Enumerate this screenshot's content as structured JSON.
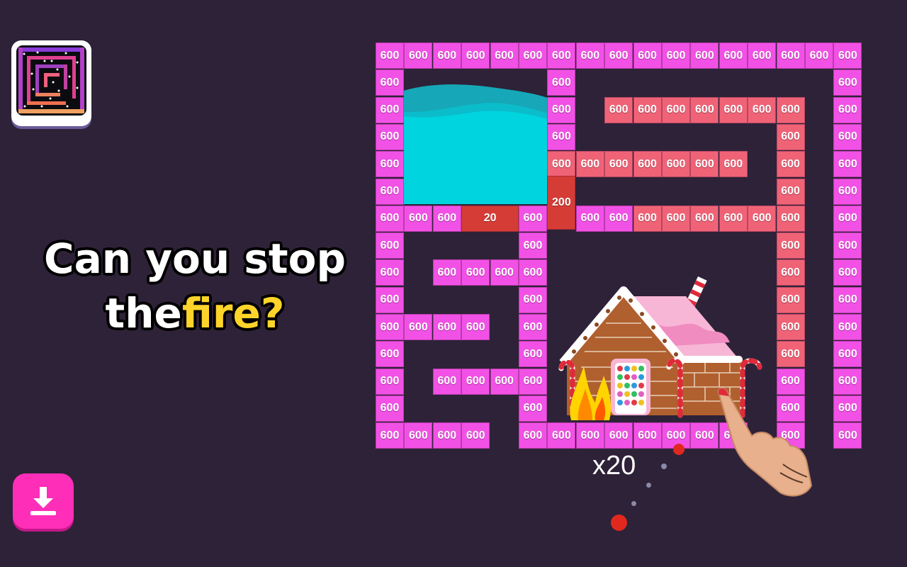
{
  "game": {
    "headline_line1": "Can you stop",
    "headline_line2_prefix": "the",
    "headline_line2_highlight": "fire?",
    "multiplier": "x20",
    "colors": {
      "background": "#2e2238",
      "brick_magenta": "#f251e6",
      "brick_salmon": "#f06377",
      "brick_red": "#d63c36",
      "water": "#00d4de",
      "download_button": "#ff2eb8",
      "highlight_text": "#ffd42a",
      "ball": "#e0281e"
    }
  },
  "bricks": [
    {
      "row": 0,
      "col": 0,
      "value": "600",
      "color": "m"
    },
    {
      "row": 0,
      "col": 1,
      "value": "600",
      "color": "m"
    },
    {
      "row": 0,
      "col": 2,
      "value": "600",
      "color": "m"
    },
    {
      "row": 0,
      "col": 3,
      "value": "600",
      "color": "m"
    },
    {
      "row": 0,
      "col": 4,
      "value": "600",
      "color": "m"
    },
    {
      "row": 0,
      "col": 5,
      "value": "600",
      "color": "m"
    },
    {
      "row": 0,
      "col": 6,
      "value": "600",
      "color": "m"
    },
    {
      "row": 0,
      "col": 7,
      "value": "600",
      "color": "m"
    },
    {
      "row": 0,
      "col": 8,
      "value": "600",
      "color": "m"
    },
    {
      "row": 0,
      "col": 9,
      "value": "600",
      "color": "m"
    },
    {
      "row": 0,
      "col": 10,
      "value": "600",
      "color": "m"
    },
    {
      "row": 0,
      "col": 11,
      "value": "600",
      "color": "m"
    },
    {
      "row": 0,
      "col": 12,
      "value": "600",
      "color": "m"
    },
    {
      "row": 0,
      "col": 13,
      "value": "600",
      "color": "m"
    },
    {
      "row": 0,
      "col": 14,
      "value": "600",
      "color": "m"
    },
    {
      "row": 0,
      "col": 15,
      "value": "600",
      "color": "m"
    },
    {
      "row": 0,
      "col": 16,
      "value": "600",
      "color": "m"
    },
    {
      "row": 1,
      "col": 0,
      "value": "600",
      "color": "m"
    },
    {
      "row": 1,
      "col": 6,
      "value": "600",
      "color": "m"
    },
    {
      "row": 1,
      "col": 16,
      "value": "600",
      "color": "m"
    },
    {
      "row": 2,
      "col": 0,
      "value": "600",
      "color": "m"
    },
    {
      "row": 2,
      "col": 6,
      "value": "600",
      "color": "m"
    },
    {
      "row": 2,
      "col": 8,
      "value": "600",
      "color": "s"
    },
    {
      "row": 2,
      "col": 9,
      "value": "600",
      "color": "s"
    },
    {
      "row": 2,
      "col": 10,
      "value": "600",
      "color": "s"
    },
    {
      "row": 2,
      "col": 11,
      "value": "600",
      "color": "s"
    },
    {
      "row": 2,
      "col": 12,
      "value": "600",
      "color": "s"
    },
    {
      "row": 2,
      "col": 13,
      "value": "600",
      "color": "s"
    },
    {
      "row": 2,
      "col": 14,
      "value": "600",
      "color": "s"
    },
    {
      "row": 2,
      "col": 16,
      "value": "600",
      "color": "m"
    },
    {
      "row": 3,
      "col": 0,
      "value": "600",
      "color": "m"
    },
    {
      "row": 3,
      "col": 6,
      "value": "600",
      "color": "m"
    },
    {
      "row": 3,
      "col": 14,
      "value": "600",
      "color": "s"
    },
    {
      "row": 3,
      "col": 16,
      "value": "600",
      "color": "m"
    },
    {
      "row": 4,
      "col": 0,
      "value": "600",
      "color": "m"
    },
    {
      "row": 4,
      "col": 6,
      "value": "600",
      "color": "s"
    },
    {
      "row": 4,
      "col": 7,
      "value": "600",
      "color": "s"
    },
    {
      "row": 4,
      "col": 8,
      "value": "600",
      "color": "s"
    },
    {
      "row": 4,
      "col": 9,
      "value": "600",
      "color": "s"
    },
    {
      "row": 4,
      "col": 10,
      "value": "600",
      "color": "s"
    },
    {
      "row": 4,
      "col": 11,
      "value": "600",
      "color": "s"
    },
    {
      "row": 4,
      "col": 12,
      "value": "600",
      "color": "s"
    },
    {
      "row": 4,
      "col": 14,
      "value": "600",
      "color": "s"
    },
    {
      "row": 4,
      "col": 16,
      "value": "600",
      "color": "m"
    },
    {
      "row": 5,
      "col": 0,
      "value": "600",
      "color": "m"
    },
    {
      "row": 5,
      "col": 6,
      "value": "200",
      "color": "r",
      "tall": true
    },
    {
      "row": 5,
      "col": 14,
      "value": "600",
      "color": "s"
    },
    {
      "row": 5,
      "col": 16,
      "value": "600",
      "color": "m"
    },
    {
      "row": 6,
      "col": 0,
      "value": "600",
      "color": "m"
    },
    {
      "row": 6,
      "col": 1,
      "value": "600",
      "color": "m"
    },
    {
      "row": 6,
      "col": 2,
      "value": "600",
      "color": "m"
    },
    {
      "row": 6,
      "col": 3,
      "value": "20",
      "color": "r",
      "wide": true
    },
    {
      "row": 6,
      "col": 5,
      "value": "600",
      "color": "m"
    },
    {
      "row": 6,
      "col": 7,
      "value": "600",
      "color": "m"
    },
    {
      "row": 6,
      "col": 8,
      "value": "600",
      "color": "m"
    },
    {
      "row": 6,
      "col": 9,
      "value": "600",
      "color": "s"
    },
    {
      "row": 6,
      "col": 10,
      "value": "600",
      "color": "s"
    },
    {
      "row": 6,
      "col": 11,
      "value": "600",
      "color": "s"
    },
    {
      "row": 6,
      "col": 12,
      "value": "600",
      "color": "s"
    },
    {
      "row": 6,
      "col": 13,
      "value": "600",
      "color": "s"
    },
    {
      "row": 6,
      "col": 14,
      "value": "600",
      "color": "s"
    },
    {
      "row": 6,
      "col": 16,
      "value": "600",
      "color": "m"
    },
    {
      "row": 7,
      "col": 0,
      "value": "600",
      "color": "m"
    },
    {
      "row": 7,
      "col": 5,
      "value": "600",
      "color": "m"
    },
    {
      "row": 7,
      "col": 14,
      "value": "600",
      "color": "s"
    },
    {
      "row": 7,
      "col": 16,
      "value": "600",
      "color": "m"
    },
    {
      "row": 8,
      "col": 0,
      "value": "600",
      "color": "m"
    },
    {
      "row": 8,
      "col": 2,
      "value": "600",
      "color": "m"
    },
    {
      "row": 8,
      "col": 3,
      "value": "600",
      "color": "m"
    },
    {
      "row": 8,
      "col": 4,
      "value": "600",
      "color": "m"
    },
    {
      "row": 8,
      "col": 5,
      "value": "600",
      "color": "m"
    },
    {
      "row": 8,
      "col": 14,
      "value": "600",
      "color": "s"
    },
    {
      "row": 8,
      "col": 16,
      "value": "600",
      "color": "m"
    },
    {
      "row": 9,
      "col": 0,
      "value": "600",
      "color": "m"
    },
    {
      "row": 9,
      "col": 5,
      "value": "600",
      "color": "m"
    },
    {
      "row": 9,
      "col": 14,
      "value": "600",
      "color": "s"
    },
    {
      "row": 9,
      "col": 16,
      "value": "600",
      "color": "m"
    },
    {
      "row": 10,
      "col": 0,
      "value": "600",
      "color": "m"
    },
    {
      "row": 10,
      "col": 1,
      "value": "600",
      "color": "m"
    },
    {
      "row": 10,
      "col": 2,
      "value": "600",
      "color": "m"
    },
    {
      "row": 10,
      "col": 3,
      "value": "600",
      "color": "m"
    },
    {
      "row": 10,
      "col": 5,
      "value": "600",
      "color": "m"
    },
    {
      "row": 10,
      "col": 14,
      "value": "600",
      "color": "s"
    },
    {
      "row": 10,
      "col": 16,
      "value": "600",
      "color": "m"
    },
    {
      "row": 11,
      "col": 0,
      "value": "600",
      "color": "m"
    },
    {
      "row": 11,
      "col": 5,
      "value": "600",
      "color": "m"
    },
    {
      "row": 11,
      "col": 14,
      "value": "600",
      "color": "s"
    },
    {
      "row": 11,
      "col": 16,
      "value": "600",
      "color": "m"
    },
    {
      "row": 12,
      "col": 0,
      "value": "600",
      "color": "m"
    },
    {
      "row": 12,
      "col": 2,
      "value": "600",
      "color": "m"
    },
    {
      "row": 12,
      "col": 3,
      "value": "600",
      "color": "m"
    },
    {
      "row": 12,
      "col": 4,
      "value": "600",
      "color": "m"
    },
    {
      "row": 12,
      "col": 5,
      "value": "600",
      "color": "m"
    },
    {
      "row": 12,
      "col": 14,
      "value": "600",
      "color": "m"
    },
    {
      "row": 12,
      "col": 16,
      "value": "600",
      "color": "m"
    },
    {
      "row": 13,
      "col": 0,
      "value": "600",
      "color": "m"
    },
    {
      "row": 13,
      "col": 5,
      "value": "600",
      "color": "m"
    },
    {
      "row": 13,
      "col": 14,
      "value": "600",
      "color": "m"
    },
    {
      "row": 13,
      "col": 16,
      "value": "600",
      "color": "m"
    },
    {
      "row": 14,
      "col": 0,
      "value": "600",
      "color": "m"
    },
    {
      "row": 14,
      "col": 1,
      "value": "600",
      "color": "m"
    },
    {
      "row": 14,
      "col": 2,
      "value": "600",
      "color": "m"
    },
    {
      "row": 14,
      "col": 3,
      "value": "600",
      "color": "m"
    },
    {
      "row": 14,
      "col": 5,
      "value": "600",
      "color": "m"
    },
    {
      "row": 14,
      "col": 6,
      "value": "600",
      "color": "m"
    },
    {
      "row": 14,
      "col": 7,
      "value": "600",
      "color": "m"
    },
    {
      "row": 14,
      "col": 8,
      "value": "600",
      "color": "m"
    },
    {
      "row": 14,
      "col": 9,
      "value": "600",
      "color": "m"
    },
    {
      "row": 14,
      "col": 10,
      "value": "600",
      "color": "m"
    },
    {
      "row": 14,
      "col": 11,
      "value": "600",
      "color": "m"
    },
    {
      "row": 14,
      "col": 12,
      "value": "600",
      "color": "m"
    },
    {
      "row": 14,
      "col": 14,
      "value": "600",
      "color": "m"
    },
    {
      "row": 14,
      "col": 16,
      "value": "600",
      "color": "m"
    }
  ]
}
